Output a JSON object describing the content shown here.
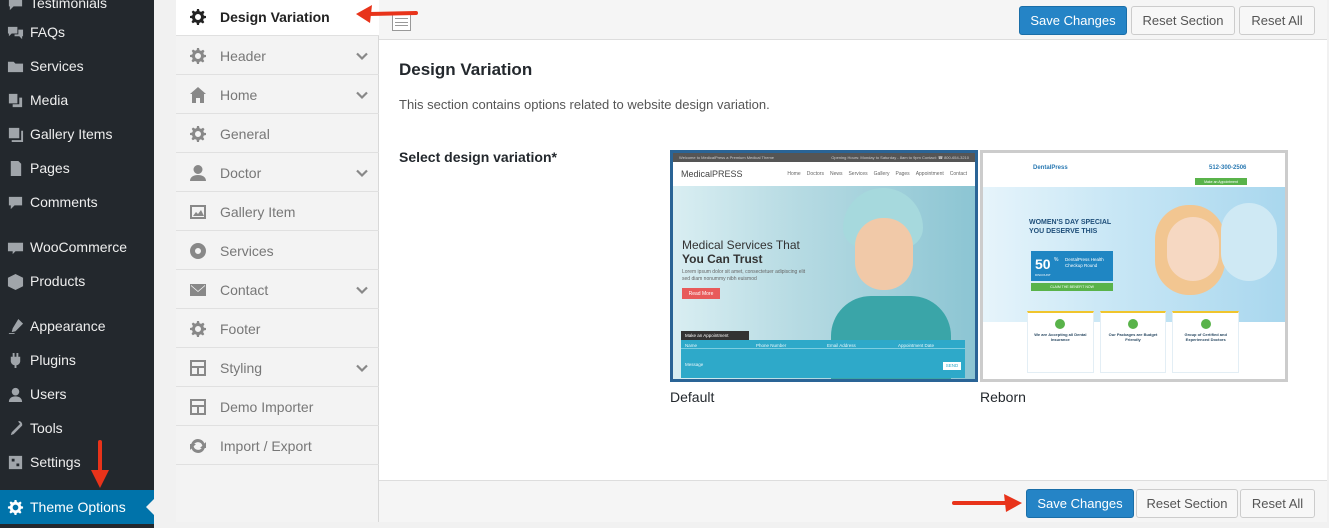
{
  "wp_menu": [
    {
      "label": "Testimonials",
      "icon": "testimonial-icon"
    },
    {
      "label": "FAQs",
      "icon": "faq-icon"
    },
    {
      "label": "Services",
      "icon": "folder-icon"
    },
    {
      "label": "Media",
      "icon": "media-icon"
    },
    {
      "label": "Gallery Items",
      "icon": "gallery-icon"
    },
    {
      "label": "Pages",
      "icon": "pages-icon"
    },
    {
      "label": "Comments",
      "icon": "comments-icon"
    },
    {
      "label": "WooCommerce",
      "icon": "woocommerce-icon"
    },
    {
      "label": "Products",
      "icon": "products-icon"
    },
    {
      "label": "Appearance",
      "icon": "appearance-icon"
    },
    {
      "label": "Plugins",
      "icon": "plugins-icon"
    },
    {
      "label": "Users",
      "icon": "users-icon"
    },
    {
      "label": "Tools",
      "icon": "tools-icon"
    },
    {
      "label": "Settings",
      "icon": "settings-icon"
    },
    {
      "label": "Theme Options",
      "icon": "gear-icon",
      "active": true
    }
  ],
  "redux_menu": [
    {
      "label": "Design Variation",
      "icon": "gear-icon",
      "active": true
    },
    {
      "label": "Header",
      "icon": "gear-icon",
      "expandable": true
    },
    {
      "label": "Home",
      "icon": "home-icon",
      "expandable": true
    },
    {
      "label": "General",
      "icon": "gear-icon"
    },
    {
      "label": "Doctor",
      "icon": "user-icon",
      "expandable": true
    },
    {
      "label": "Gallery Item",
      "icon": "image-icon"
    },
    {
      "label": "Services",
      "icon": "cog-icon"
    },
    {
      "label": "Contact",
      "icon": "envelope-icon",
      "expandable": true
    },
    {
      "label": "Footer",
      "icon": "gear-icon"
    },
    {
      "label": "Styling",
      "icon": "layout-icon",
      "expandable": true
    },
    {
      "label": "Demo Importer",
      "icon": "layout-icon"
    },
    {
      "label": "Import / Export",
      "icon": "refresh-icon"
    }
  ],
  "buttons": {
    "save": "Save Changes",
    "reset_section": "Reset Section",
    "reset_all": "Reset All"
  },
  "section": {
    "title": "Design Variation",
    "description": "This section contains options related to website design variation.",
    "field_label": "Select design variation*",
    "options": [
      {
        "caption": "Default",
        "selected": true,
        "preview": {
          "topbar_left": "Welcome to MedicalPress a Premium Medical Theme",
          "topbar_right": "Opening Hours: Monday to Saturday - 8am to 9pm   Contact: ☎ 800-654-3210",
          "logo": "MedicalPRESS",
          "nav": [
            "Home",
            "Doctors",
            "News",
            "Services",
            "Gallery",
            "Pages",
            "Appointment",
            "Contact"
          ],
          "headline_1": "Medical Services That",
          "headline_2": "You Can Trust",
          "body_1": "Lorem ipsum dolor sit amet, consectetuer adipiscing elit",
          "body_2": "sed diam nonummy nibh euismod",
          "cta": "Read More",
          "form_title": "Make an Appointment",
          "form_fields": [
            "Name",
            "Phone Number",
            "Email Address",
            "Appointment Date"
          ],
          "form_message": "Message",
          "form_send": "SEND"
        }
      },
      {
        "caption": "Reborn",
        "selected": false,
        "preview": {
          "logo": "DentalPress",
          "phone": "512-300-2506",
          "appointment_btn": "Make an Appointment",
          "headline_1": "WOMEN'S DAY SPECIAL",
          "headline_2": "YOU DESERVE THIS",
          "badge_number": "50",
          "badge_unit": "%",
          "badge_label": "DISCOUNT",
          "badge_text": "DentalPress Health Checkup Round",
          "badge_cta": "CLAIM THE BENEFIT NOW",
          "features": [
            "We are Accepting all Dental Insurance",
            "Our Packages are Budget Friendly",
            "Group of Certified and Experienced Doctors"
          ]
        }
      }
    ]
  },
  "colors": {
    "wp_sidebar": "#23282d",
    "wp_active": "#0073aa",
    "primary_button": "#2584c6",
    "annotation_arrow": "#e8331a"
  }
}
